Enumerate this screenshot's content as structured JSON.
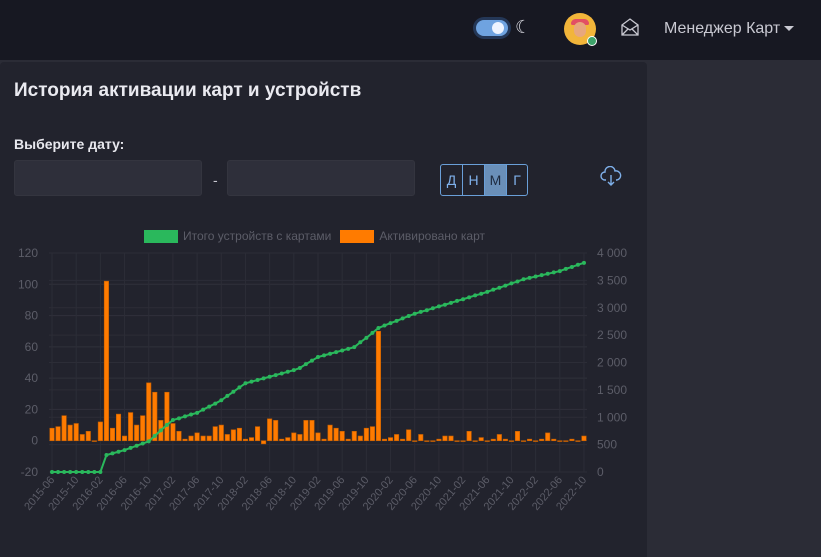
{
  "header": {
    "theme_toggle_on": true,
    "theme_icon": "moon-icon",
    "user_name": "Менеджер Карт",
    "mail_icon": "envelope-open-icon"
  },
  "card": {
    "title": "История активации карт и устройств",
    "date_label": "Выберите дату:",
    "date_from": "",
    "date_to": "",
    "separator": "-",
    "period_buttons": [
      {
        "label": "Д",
        "active": false
      },
      {
        "label": "Н",
        "active": false
      },
      {
        "label": "М",
        "active": true
      },
      {
        "label": "Г",
        "active": false
      }
    ],
    "download_icon": "cloud-download-icon"
  },
  "chart_data": {
    "type": "bar+line",
    "legend": [
      "Итого устройств с картами",
      "Активировано карт"
    ],
    "legend_placement": "top-center",
    "colors": {
      "line": "#2ab85c",
      "bar": "#ff7b00"
    },
    "x_start": "2015-06",
    "x_end": "2022-10",
    "x_tick_labels": [
      "2015-06",
      "2015-10",
      "2016-02",
      "2016-06",
      "2016-10",
      "2017-02",
      "2017-06",
      "2017-10",
      "2018-02",
      "2018-06",
      "2018-10",
      "2019-02",
      "2019-06",
      "2019-10",
      "2020-02",
      "2020-06",
      "2020-10",
      "2021-02",
      "2021-06",
      "2021-10",
      "2022-02",
      "2022-06",
      "2022-10"
    ],
    "y_left": {
      "ticks": [
        "-20",
        "0",
        "20",
        "40",
        "60",
        "80",
        "100",
        "120"
      ],
      "range": [
        -20,
        120
      ]
    },
    "y_right": {
      "ticks": [
        "0",
        "500",
        "1 000",
        "1 500",
        "2 000",
        "2 500",
        "3 000",
        "3 500",
        "4 000"
      ],
      "range": [
        0,
        4000
      ]
    },
    "grid": true,
    "series": [
      {
        "name": "Активировано карт",
        "type": "bar",
        "axis": "left",
        "values": [
          8,
          9,
          16,
          10,
          11,
          4,
          6,
          0,
          12,
          102,
          8,
          17,
          3,
          18,
          10,
          16,
          37,
          31,
          13,
          31,
          11,
          6,
          1,
          3,
          5,
          3,
          3,
          9,
          10,
          4,
          7,
          8,
          1,
          2,
          9,
          -2,
          14,
          13,
          1,
          2,
          5,
          4,
          13,
          13,
          5,
          1,
          10,
          8,
          6,
          1,
          6,
          3,
          8,
          9,
          70,
          1,
          2,
          4,
          1,
          7,
          0,
          4,
          0,
          0,
          1,
          3,
          3,
          0,
          0,
          6,
          0,
          2,
          0,
          1,
          4,
          1,
          0,
          6,
          0,
          1,
          0,
          1,
          5,
          1,
          0,
          0,
          1,
          0,
          3
        ]
      },
      {
        "name": "Итого устройств с картами",
        "type": "line",
        "axis": "right",
        "values": [
          0,
          0,
          0,
          0,
          0,
          0,
          0,
          0,
          0,
          310,
          340,
          370,
          400,
          440,
          480,
          520,
          560,
          660,
          760,
          860,
          950,
          980,
          1015,
          1050,
          1080,
          1140,
          1195,
          1250,
          1310,
          1390,
          1465,
          1545,
          1620,
          1650,
          1680,
          1710,
          1740,
          1770,
          1800,
          1830,
          1860,
          1900,
          1970,
          2035,
          2100,
          2130,
          2160,
          2190,
          2220,
          2250,
          2280,
          2370,
          2450,
          2540,
          2630,
          2675,
          2720,
          2760,
          2805,
          2850,
          2890,
          2925,
          2955,
          2990,
          3025,
          3055,
          3090,
          3125,
          3155,
          3190,
          3225,
          3255,
          3290,
          3330,
          3365,
          3405,
          3445,
          3480,
          3520,
          3545,
          3570,
          3595,
          3620,
          3645,
          3670,
          3710,
          3745,
          3785,
          3820
        ]
      }
    ]
  }
}
